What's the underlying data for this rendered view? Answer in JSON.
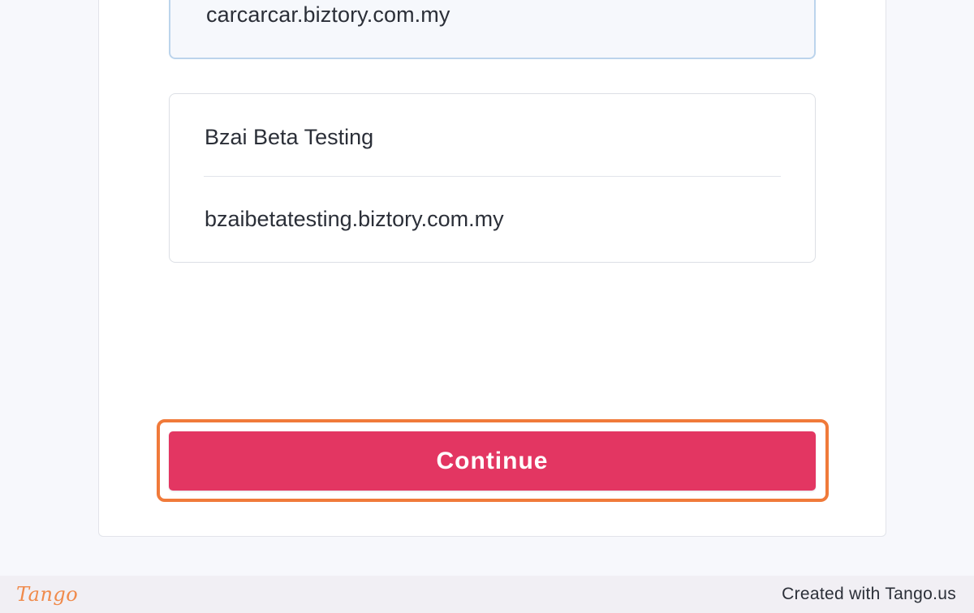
{
  "companies": [
    {
      "domain": "carcarcar.biztory.com.my",
      "selected": true
    },
    {
      "name": "Bzai Beta Testing",
      "domain": "bzaibetatesting.biztory.com.my",
      "selected": false
    }
  ],
  "continue_label": "Continue",
  "footer": {
    "logo": "Tango",
    "credit": "Created with Tango.us"
  },
  "colors": {
    "primary_button": "#e33662",
    "highlight": "#f07a3a",
    "selected_border": "#bcd4ec",
    "page_background": "#f7f8fc"
  }
}
